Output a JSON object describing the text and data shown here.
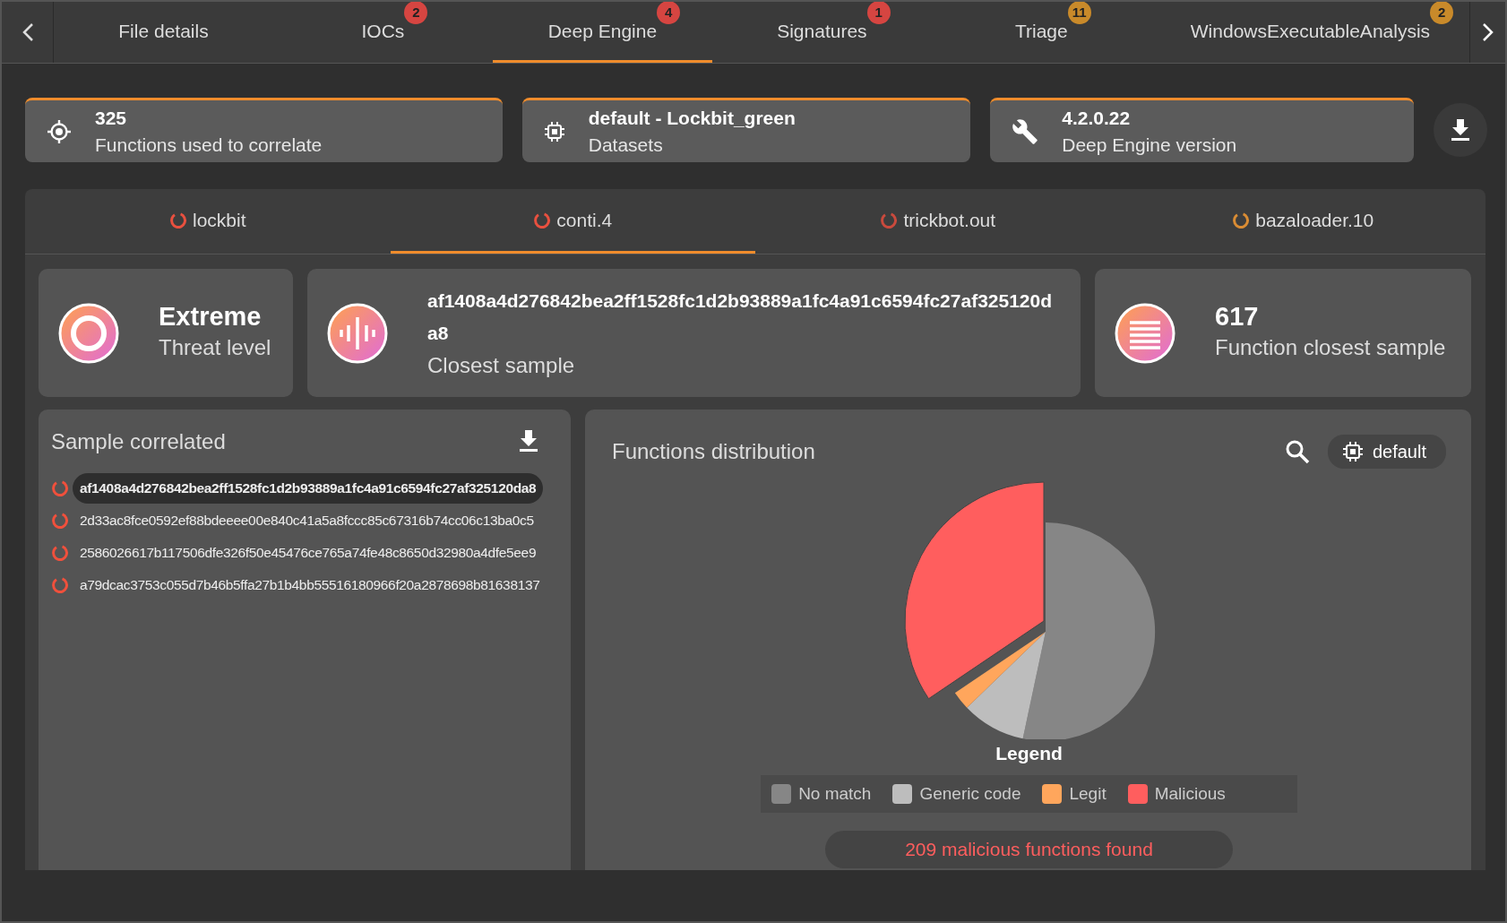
{
  "tabs": [
    {
      "label": "File details",
      "selected": false
    },
    {
      "label": "IOCs",
      "selected": false,
      "badge": "2",
      "color": "#d64541"
    },
    {
      "label": "Deep Engine",
      "selected": true,
      "badge": "4",
      "color": "#d64541"
    },
    {
      "label": "Signatures",
      "selected": false,
      "badge": "1",
      "color": "#d64541"
    },
    {
      "label": "Triage",
      "selected": false,
      "badge": "11",
      "color": "#c98a2a"
    },
    {
      "label": "WindowsExecutableAnalysis",
      "selected": false,
      "badge": "2",
      "color": "#c98a2a"
    }
  ],
  "info_cards": [
    {
      "kind": "target",
      "value": "325",
      "label": "Functions used to correlate"
    },
    {
      "kind": "chip",
      "value": "default - Lockbit_green",
      "label": "Datasets"
    },
    {
      "kind": "wrench",
      "value": "4.2.0.22",
      "label": "Deep Engine version"
    }
  ],
  "sample_tabs": [
    {
      "label": "lockbit",
      "selected": false,
      "color": "#e8503f"
    },
    {
      "label": "conti.4",
      "selected": true,
      "color": "#e8503f"
    },
    {
      "label": "trickbot.out",
      "selected": false,
      "color": "#c94a3d"
    },
    {
      "label": "bazaloader.10",
      "selected": false,
      "color": "#d98c34"
    }
  ],
  "stats": [
    {
      "kind": "ring",
      "value": "Extreme",
      "label": "Threat level"
    },
    {
      "kind": "wave",
      "value": "af1408a4d276842bea2ff1528fc1d2b93889a1fc4a91c6594fc27af325120da8",
      "label": "Closest sample"
    },
    {
      "kind": "list",
      "value": "617",
      "label": "Function closest sample"
    }
  ],
  "sample_correlated": {
    "title": "Sample correlated",
    "items": [
      {
        "hash": "af1408a4d276842bea2ff1528fc1d2b93889a1fc4a91c6594fc27af325120da8",
        "selected": true
      },
      {
        "hash": "2d33ac8fce0592ef88bdeeee00e840c41a5a8fccc85c67316b74cc06c13ba0c5",
        "selected": false
      },
      {
        "hash": "2586026617b117506dfe326f50e45476ce765a74fe48c8650d32980a4dfe5ee9",
        "selected": false
      },
      {
        "hash": "a79dcac3753c055d7b46b5ffa27b1b4bb55516180966f20a2878698b81638137",
        "selected": false
      }
    ]
  },
  "functions_distribution": {
    "title": "Functions distribution",
    "dataset": "default",
    "legend_title": "Legend",
    "legend": [
      {
        "label": "No match",
        "color": "#868686"
      },
      {
        "label": "Generic code",
        "color": "#bdbdbd"
      },
      {
        "label": "Legit",
        "color": "#ffa65c"
      },
      {
        "label": "Malicious",
        "color": "#ff5e5e"
      }
    ],
    "summary": "209 malicious functions found"
  }
}
